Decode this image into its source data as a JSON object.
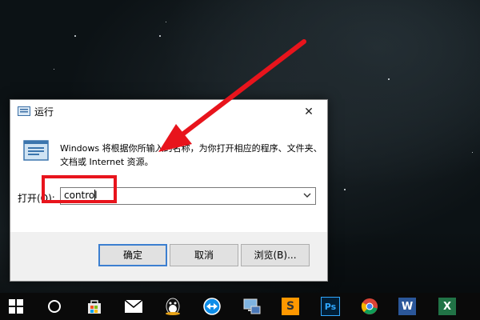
{
  "dialog": {
    "title": "运行",
    "close_glyph": "✕",
    "description": "Windows 将根据你所输入的名称，为你打开相应的程序、文件夹、文档或 Internet 资源。",
    "open_label": "打开(O):",
    "command_value": "control",
    "buttons": {
      "ok": "确定",
      "cancel": "取消",
      "browse": "浏览(B)..."
    }
  },
  "taskbar": {
    "icons": [
      "windows-start-icon",
      "cortana-circle-icon",
      "store-icon",
      "mail-icon",
      "qq-icon",
      "teamviewer-icon",
      "network-computer-icon",
      "sublime-text-icon",
      "photoshop-icon",
      "chrome-icon",
      "word-icon",
      "excel-icon"
    ],
    "labels": {
      "sublime": "S",
      "photoshop": "Ps",
      "word": "W",
      "excel": "X"
    }
  },
  "colors": {
    "annotation_red": "#e8141c",
    "accent_blue": "#3c7fd0",
    "desktop_bg": "#0c1215"
  }
}
